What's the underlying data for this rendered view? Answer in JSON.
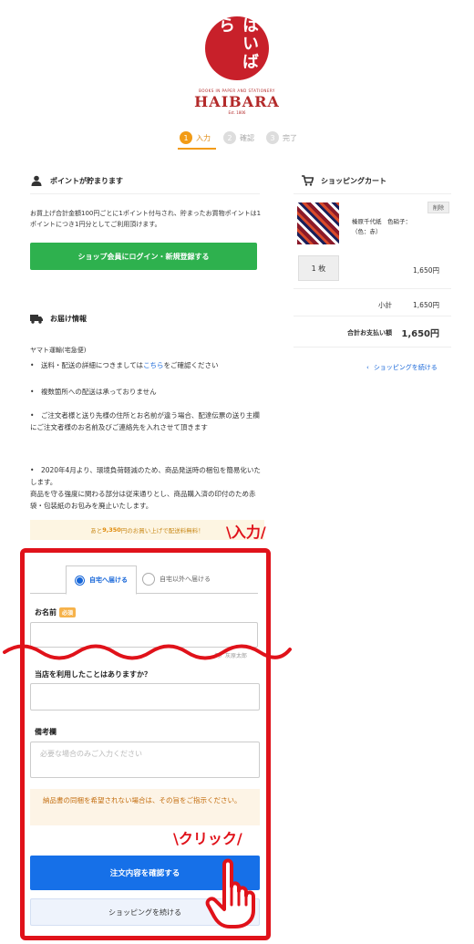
{
  "brand": {
    "logo_text": "はいばら",
    "sub_top": "BOOKS IN PAPER AND STATIONERY",
    "name": "HAIBARA",
    "since": "Est. 1806"
  },
  "steps": [
    {
      "num": "1",
      "label": "入力"
    },
    {
      "num": "2",
      "label": "確認"
    },
    {
      "num": "3",
      "label": "完了"
    }
  ],
  "points": {
    "title": "ポイントが貯まります",
    "desc": "お買上げ合計金額100円ごとに1ポイント付与され、貯まったお買物ポイントは1ポイントにつき1円分としてご利用頂けます。",
    "login_button": "ショップ会員にログイン・新規登録する"
  },
  "delivery": {
    "title": "お届け情報",
    "carrier": "ヤマト運輸(宅急便)",
    "bullet1_pre": "送料・配送の詳細につきましては",
    "bullet1_link": "こちら",
    "bullet1_post": "をご確認ください",
    "bullet2": "複数箇所への配送は承っておりません",
    "bullet3": "ご注文者様と送り先様の住所とお名前が違う場合、配達伝票の送り主欄にご注文者様のお名前及びご連絡先を入れさせて頂きます",
    "bullet4": "2020年4月より、環境負荷軽減のため、商品発送時の梱包を簡易化いたします。",
    "bullet4_cont": "商品を守る強度に関わる部分は従来通りとし、商品購入済の印付のため赤袋・包装紙のお包みを廃止いたします。",
    "notice_pre": "あと ",
    "notice_amount": "9,350",
    "notice_post": "円のお買い上げで配送料無料！"
  },
  "form": {
    "tab_home": "自宅へ届ける",
    "tab_other": "自宅以外へ届ける",
    "name_label": "お名前",
    "required": "必須",
    "name_example": "例）灰原太郎",
    "visited_label": "当店を利用したことはありますか？",
    "note_label": "備考欄",
    "note_placeholder": "必要な場合のみご入力ください",
    "warning": "納品書の同梱を希望されない場合は、その旨をご指示ください。",
    "confirm_button": "注文内容を確認する",
    "continue_button": "ショッピングを続ける"
  },
  "annotations": {
    "input": "\\入力/",
    "click": "\\クリック/"
  },
  "cart": {
    "title": "ショッピングカート",
    "delete": "削除",
    "item_name": "榛原千代紙　色硝子：（色：赤）",
    "qty": "1 枚",
    "item_price": "1,650円",
    "subtotal_label": "小計",
    "subtotal": "1,650円",
    "total_label": "合計お支払い額",
    "total": "1,650円",
    "continue_link": "ショッピングを続ける"
  },
  "colors": {
    "brand_red": "#c8202a",
    "step_orange": "#f29b16",
    "login_green": "#2eb14e",
    "primary_blue": "#1670e8",
    "annotation_red": "#e0121a"
  }
}
